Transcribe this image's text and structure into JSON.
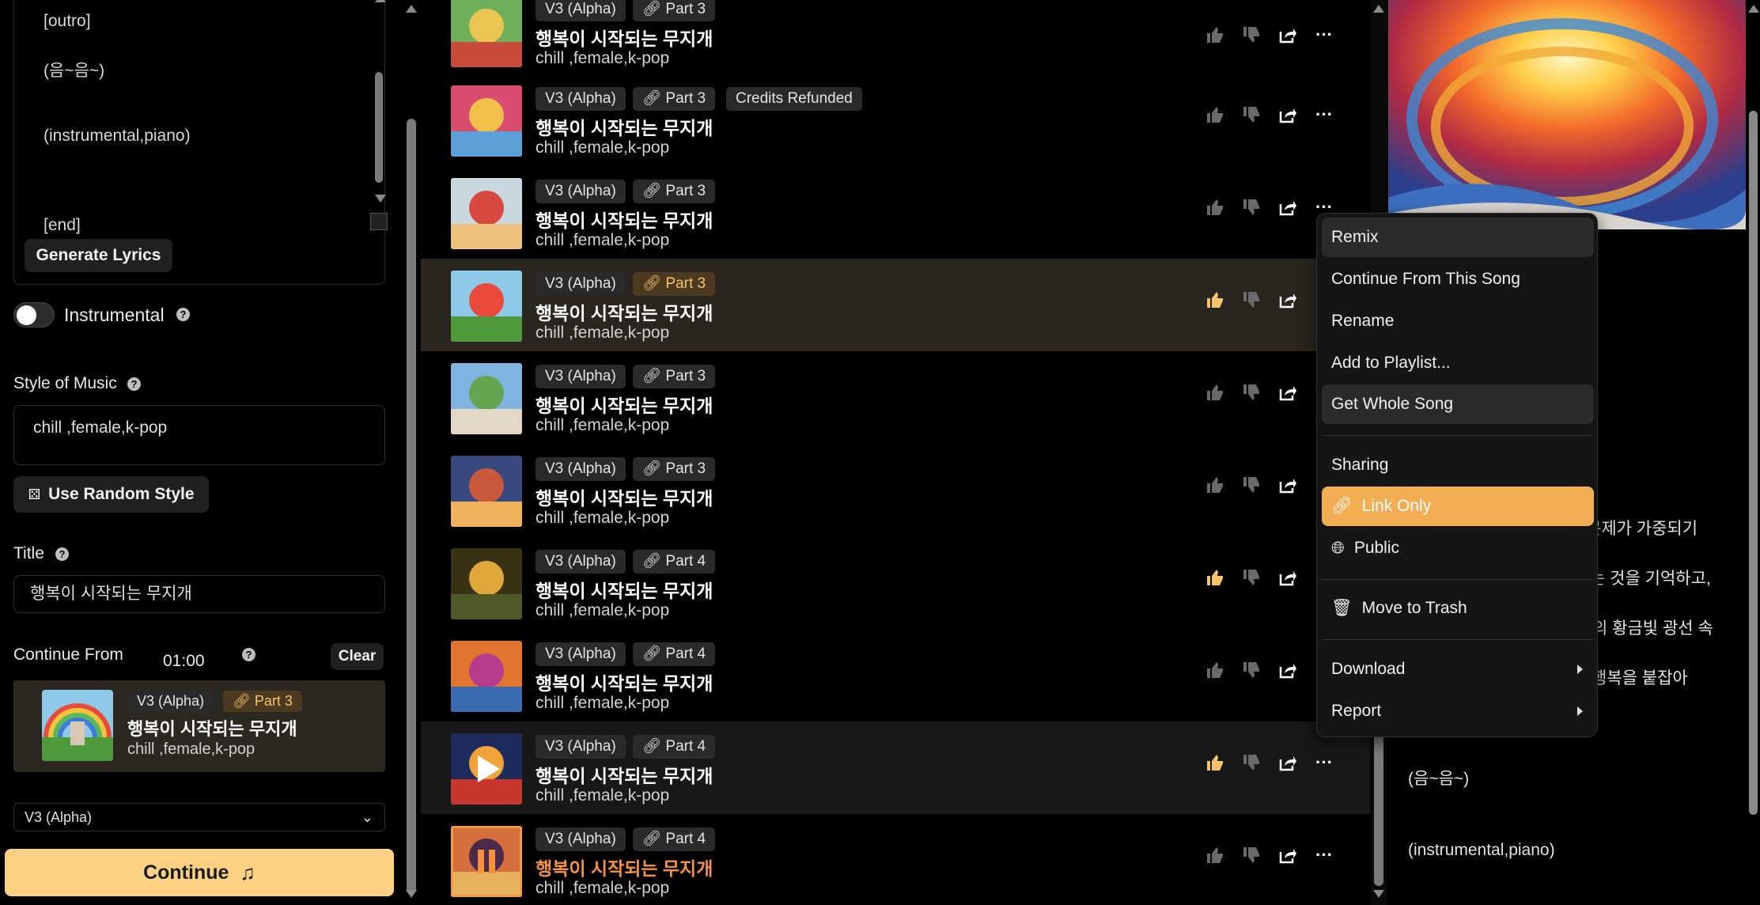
{
  "left": {
    "lyrics_lines": [
      "[outro]",
      "(음~음~)",
      "(instrumental,piano)",
      "[end]"
    ],
    "generate_lyrics": "Generate Lyrics",
    "instrumental_label": "Instrumental",
    "instrumental_on": false,
    "style_label": "Style of Music",
    "style_value": "chill ,female,k-pop",
    "random_style": "Use Random Style",
    "title_label": "Title",
    "title_value": "행복이 시작되는 무지개",
    "continue_from_label": "Continue From",
    "continue_from_time": "01:00",
    "clear_label": "Clear",
    "cf_card": {
      "model": "V3 (Alpha)",
      "part": "Part 3",
      "title": "행복이 시작되는 무지개",
      "tags": "chill ,female,k-pop"
    },
    "model_select": "V3 (Alpha)",
    "continue_button": "Continue"
  },
  "list": {
    "rows": [
      {
        "model": "V3 (Alpha)",
        "part": "Part 3",
        "title": "행복이 시작되는 무지개",
        "tags": "chill ,female,k-pop",
        "liked": false
      },
      {
        "model": "V3 (Alpha)",
        "part": "Part 3",
        "extra": "Credits Refunded",
        "title": "행복이 시작되는 무지개",
        "tags": "chill ,female,k-pop",
        "liked": false
      },
      {
        "model": "V3 (Alpha)",
        "part": "Part 3",
        "title": "행복이 시작되는 무지개",
        "tags": "chill ,female,k-pop",
        "liked": false
      },
      {
        "model": "V3 (Alpha)",
        "part": "Part 3",
        "title": "행복이 시작되는 무지개",
        "tags": "chill ,female,k-pop",
        "liked": true
      },
      {
        "model": "V3 (Alpha)",
        "part": "Part 3",
        "title": "행복이 시작되는 무지개",
        "tags": "chill ,female,k-pop",
        "liked": false
      },
      {
        "model": "V3 (Alpha)",
        "part": "Part 3",
        "title": "행복이 시작되는 무지개",
        "tags": "chill ,female,k-pop",
        "liked": false
      },
      {
        "model": "V3 (Alpha)",
        "part": "Part 4",
        "title": "행복이 시작되는 무지개",
        "tags": "chill ,female,k-pop",
        "liked": true
      },
      {
        "model": "V3 (Alpha)",
        "part": "Part 4",
        "title": "행복이 시작되는 무지개",
        "tags": "chill ,female,k-pop",
        "liked": false
      },
      {
        "model": "V3 (Alpha)",
        "part": "Part 4",
        "title": "행복이 시작되는 무지개",
        "tags": "chill ,female,k-pop",
        "liked": true
      },
      {
        "model": "V3 (Alpha)",
        "part": "Part 4",
        "title": "행복이 시작되는 무지개",
        "tags": "chill ,female,k-pop",
        "liked": false
      }
    ]
  },
  "right": {
    "lyrics_lines": [
      "문제가 가중되기",
      "는 것을 기억하고,",
      "의 황금빛 광선 속",
      "행복을 붙잡아",
      "(음~음~)",
      "(instrumental,piano)"
    ]
  },
  "menu": {
    "remix": "Remix",
    "continue_from_song": "Continue From This Song",
    "rename": "Rename",
    "add_to_playlist": "Add to Playlist...",
    "get_whole_song": "Get Whole Song",
    "sharing": "Sharing",
    "link_only": "Link Only",
    "public": "Public",
    "move_to_trash": "Move to Trash",
    "download": "Download",
    "report": "Report"
  },
  "colors": {
    "accent": "#fcd184",
    "selected": "#f3ad53",
    "liked": "#f6c26b",
    "playing_title": "#f7913e"
  }
}
